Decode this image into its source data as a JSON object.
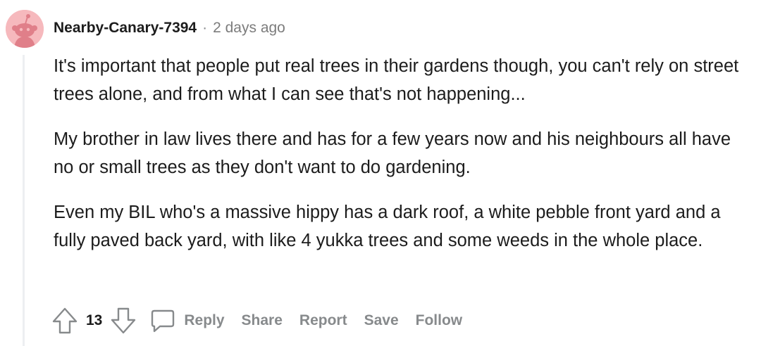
{
  "comment": {
    "author": "Nearby-Canary-7394",
    "separator": "·",
    "timestamp": "2 days ago",
    "paragraphs": [
      "It's important that people put real trees in their gardens though, you can't rely on street trees alone, and from what I can see that's not happening...",
      "My brother in law lives there and has for a few years now and his neighbours all have no or small trees as they don't want to do gardening.",
      "Even my BIL who's a massive hippy has a dark roof, a white pebble front yard and a fully paved back yard, with like 4 yukka trees and some weeds in the whole place."
    ],
    "score": "13"
  },
  "actions": {
    "reply": "Reply",
    "share": "Share",
    "report": "Report",
    "save": "Save",
    "follow": "Follow"
  },
  "icons": {
    "avatar": "snoo-avatar-icon",
    "upvote": "upvote-arrow-icon",
    "downvote": "downvote-arrow-icon",
    "reply": "speech-bubble-icon"
  },
  "colors": {
    "avatar_bg": "#f6b9bd",
    "text": "#1c1c1c",
    "muted": "#878a8c"
  }
}
